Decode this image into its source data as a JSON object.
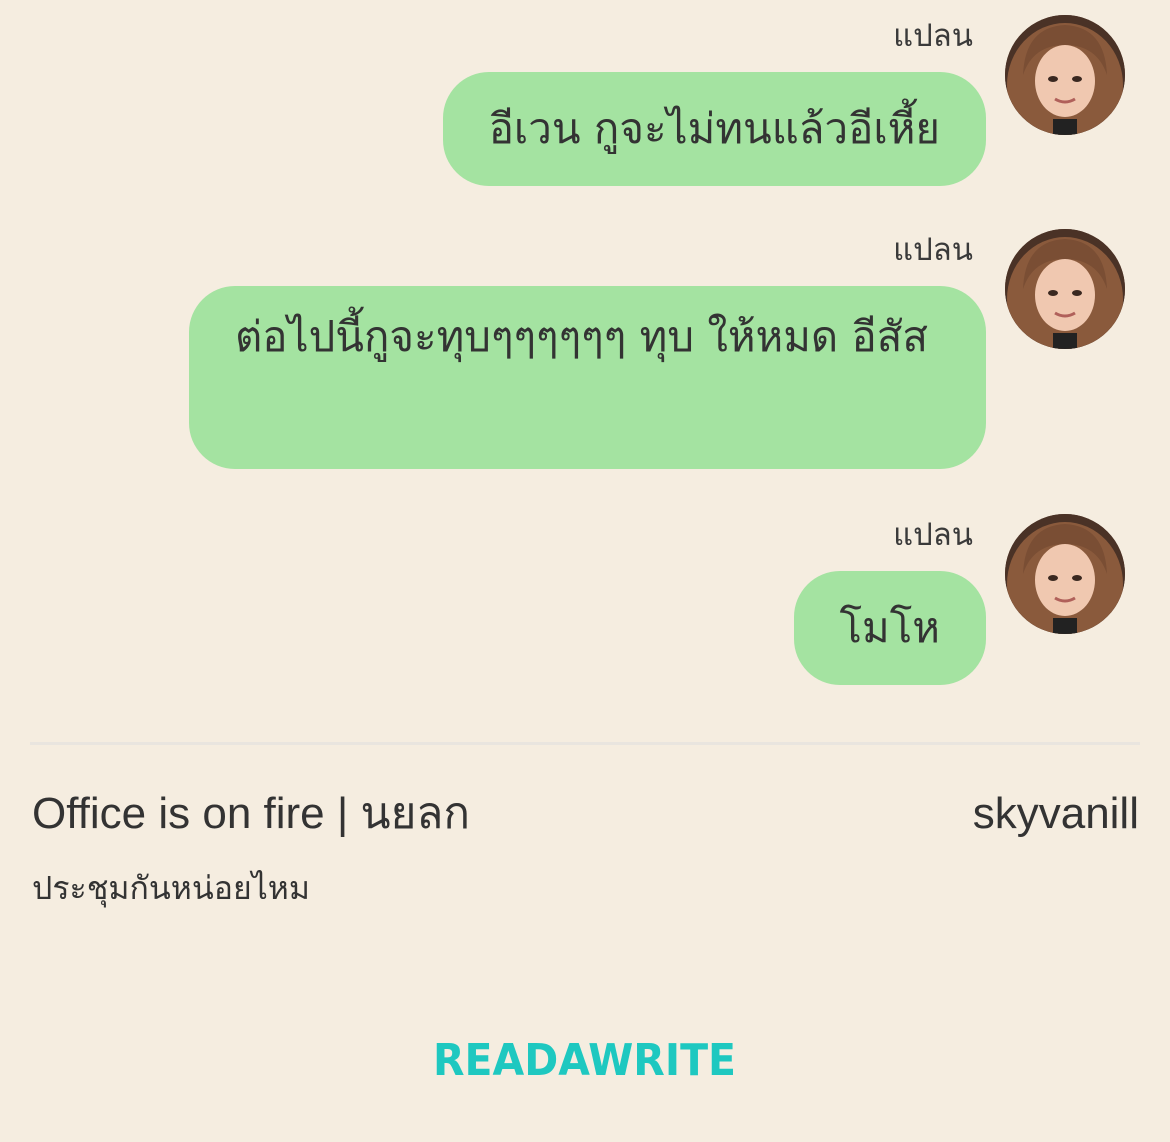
{
  "messages": [
    {
      "sender": "แปลน",
      "text": "อีเวน กูจะไม่ทนแล้วอีเหี้ย",
      "avatar_icon": "user-avatar"
    },
    {
      "sender": "แปลน",
      "text": "ต่อไปนี้กูจะทุบๆๆๆๆๆๆ ทุบ ให้หมด อีสัส",
      "avatar_icon": "user-avatar"
    },
    {
      "sender": "แปลน",
      "text": "โมโห",
      "avatar_icon": "user-avatar"
    }
  ],
  "story": {
    "title": "Office is on fire | นยลก",
    "author": "skyvanill",
    "chapter": "ประชุมกันหน่อยไหม"
  },
  "brand": {
    "name": "READAWRITE",
    "color": "#1ec8c0"
  },
  "colors": {
    "background": "#f5ede0",
    "bubble": "#a4e3a1",
    "text": "#333333",
    "divider": "#e9e5df"
  }
}
